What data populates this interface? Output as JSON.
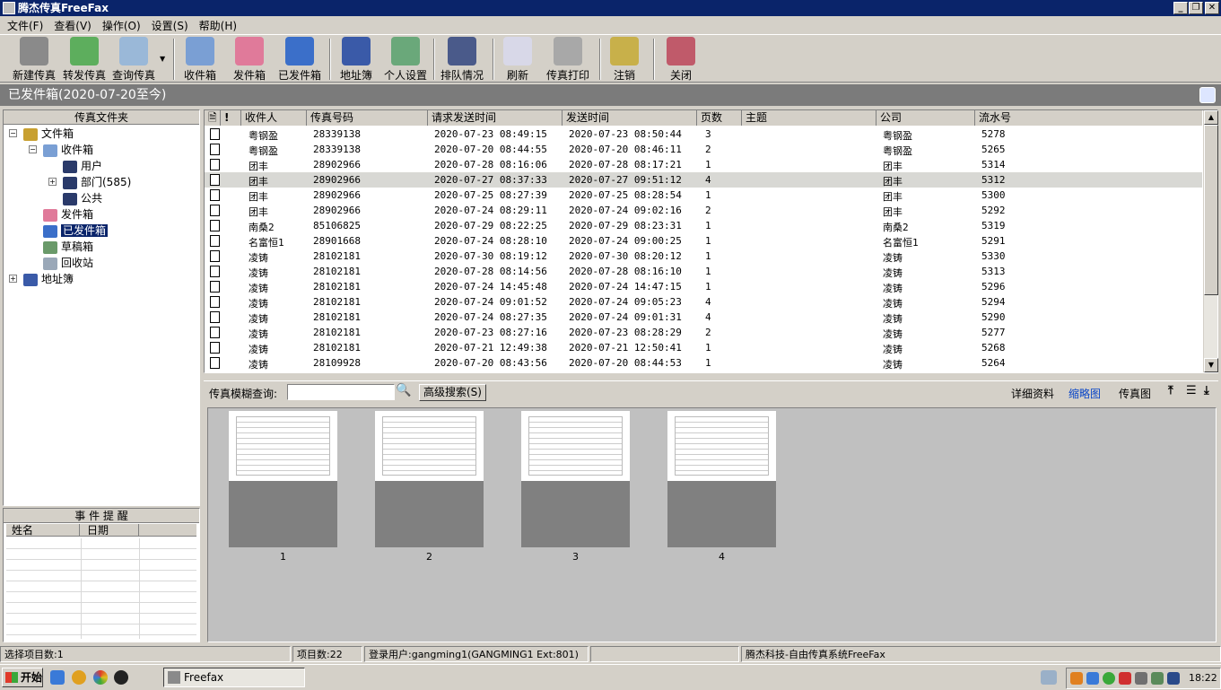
{
  "window": {
    "title": "腾杰传真FreeFax"
  },
  "menu": [
    "文件(F)",
    "查看(V)",
    "操作(O)",
    "设置(S)",
    "帮助(H)"
  ],
  "toolbar": [
    "新建传真",
    "转发传真",
    "查询传真",
    "收件箱",
    "发件箱",
    "已发件箱",
    "地址簿",
    "个人设置",
    "排队情况",
    "刷新",
    "传真打印",
    "注销",
    "关闭"
  ],
  "banner": "已发件箱(2020-07-20至今)",
  "folders": {
    "header": "传真文件夹",
    "items": [
      "文件箱",
      "收件箱",
      "用户",
      "部门(585)",
      "公共",
      "发件箱",
      "已发件箱",
      "草稿箱",
      "回收站",
      "地址簿"
    ]
  },
  "events": {
    "header": "事 件 提 醒",
    "cols": [
      "姓名",
      "日期"
    ]
  },
  "table": {
    "cols": [
      "收件人",
      "传真号码",
      "请求发送时间",
      "发送时间",
      "页数",
      "主题",
      "公司",
      "流水号"
    ],
    "rows": [
      [
        "粤钢盈",
        "28339138",
        "2020-07-23 08:49:15",
        "2020-07-23 08:50:44",
        "3",
        "",
        "粤钢盈",
        "5278"
      ],
      [
        "粤钢盈",
        "28339138",
        "2020-07-20 08:44:55",
        "2020-07-20 08:46:11",
        "2",
        "",
        "粤钢盈",
        "5265"
      ],
      [
        "团丰",
        "28902966",
        "2020-07-28 08:16:06",
        "2020-07-28 08:17:21",
        "1",
        "",
        "团丰",
        "5314"
      ],
      [
        "团丰",
        "28902966",
        "2020-07-27 08:37:33",
        "2020-07-27 09:51:12",
        "4",
        "",
        "团丰",
        "5312"
      ],
      [
        "团丰",
        "28902966",
        "2020-07-25 08:27:39",
        "2020-07-25 08:28:54",
        "1",
        "",
        "团丰",
        "5300"
      ],
      [
        "团丰",
        "28902966",
        "2020-07-24 08:29:11",
        "2020-07-24 09:02:16",
        "2",
        "",
        "团丰",
        "5292"
      ],
      [
        "南桑2",
        "85106825",
        "2020-07-29 08:22:25",
        "2020-07-29 08:23:31",
        "1",
        "",
        "南桑2",
        "5319"
      ],
      [
        "名富恒1",
        "28901668",
        "2020-07-24 08:28:10",
        "2020-07-24 09:00:25",
        "1",
        "",
        "名富恒1",
        "5291"
      ],
      [
        "凌铸",
        "28102181",
        "2020-07-30 08:19:12",
        "2020-07-30 08:20:12",
        "1",
        "",
        "凌铸",
        "5330"
      ],
      [
        "凌铸",
        "28102181",
        "2020-07-28 08:14:56",
        "2020-07-28 08:16:10",
        "1",
        "",
        "凌铸",
        "5313"
      ],
      [
        "凌铸",
        "28102181",
        "2020-07-24 14:45:48",
        "2020-07-24 14:47:15",
        "1",
        "",
        "凌铸",
        "5296"
      ],
      [
        "凌铸",
        "28102181",
        "2020-07-24 09:01:52",
        "2020-07-24 09:05:23",
        "4",
        "",
        "凌铸",
        "5294"
      ],
      [
        "凌铸",
        "28102181",
        "2020-07-24 08:27:35",
        "2020-07-24 09:01:31",
        "4",
        "",
        "凌铸",
        "5290"
      ],
      [
        "凌铸",
        "28102181",
        "2020-07-23 08:27:16",
        "2020-07-23 08:28:29",
        "2",
        "",
        "凌铸",
        "5277"
      ],
      [
        "凌铸",
        "28102181",
        "2020-07-21 12:49:38",
        "2020-07-21 12:50:41",
        "1",
        "",
        "凌铸",
        "5268"
      ],
      [
        "凌铸",
        "28109928",
        "2020-07-20 08:43:56",
        "2020-07-20 08:44:53",
        "1",
        "",
        "凌铸",
        "5264"
      ]
    ]
  },
  "search": {
    "label": "传真模糊查询:",
    "value": "",
    "advanced": "高级搜索(S)",
    "views": [
      "详细资料",
      "缩略图",
      "传真图"
    ]
  },
  "thumbs": [
    "1",
    "2",
    "3",
    "4"
  ],
  "status": [
    "选择项目数:1",
    "项目数:22",
    "登录用户:gangming1(GANGMING1 Ext:801)",
    "",
    "腾杰科技-自由传真系统FreeFax"
  ],
  "taskbar": {
    "start": "开始",
    "task": "Freefax",
    "clock": "18:22"
  }
}
